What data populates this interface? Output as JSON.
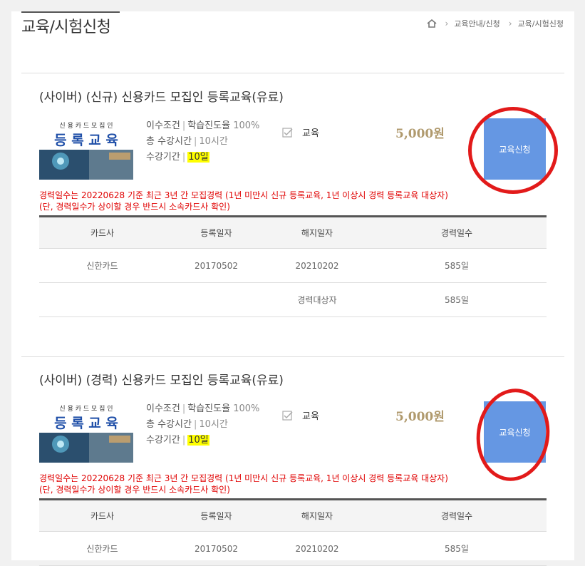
{
  "header": {
    "title": "교육/시험신청",
    "breadcrumb": [
      "교육안내/신청",
      "교육/시험신청"
    ]
  },
  "courses": [
    {
      "title": "(사이버) (신규) 신용카드 모집인 등록교육(유료)",
      "thumb_top": "신 용 카 드  모 집 인",
      "thumb_main": "등 록 교 육",
      "requirement_label": "이수조건",
      "requirement_value": "학습진도율",
      "requirement_pct": "100%",
      "hours_label": "총 수강시간",
      "hours_value": "10시간",
      "period_label": "수강기간",
      "period_value": "10일",
      "category": "교육",
      "price": "5,000원",
      "apply_label": "교육신청",
      "notice1": "경력일수는 20220628 기준 최근 3년 간 모집경력 (1년 미만시 신규 등록교육, 1년 이상시 경력 등록교육 대상자)",
      "notice2": " (단, 경력일수가 상이할 경우 반드시 소속카드사 확인)",
      "columns": [
        "카드사",
        "등록일자",
        "해지일자",
        "경력일수"
      ],
      "rows": [
        [
          "신한카드",
          "20170502",
          "20210202",
          "585일"
        ],
        [
          "",
          "",
          "경력대상자",
          "585일"
        ]
      ]
    },
    {
      "title": "(사이버) (경력) 신용카드 모집인 등록교육(유료)",
      "thumb_top": "신 용 카 드  모 집 인",
      "thumb_main": "등 록 교 육",
      "requirement_label": "이수조건",
      "requirement_value": "학습진도율",
      "requirement_pct": "100%",
      "hours_label": "총 수강시간",
      "hours_value": "10시간",
      "period_label": "수강기간",
      "period_value": "10일",
      "category": "교육",
      "price": "5,000원",
      "apply_label": "교육신청",
      "notice1": "경력일수는 20220628 기준 최근 3년 간 모집경력 (1년 미만시 신규 등록교육, 1년 이상시 경력 등록교육 대상자)",
      "notice2": " (단, 경력일수가 상이할 경우 반드시 소속카드사 확인)",
      "columns": [
        "카드사",
        "등록일자",
        "해지일자",
        "경력일수"
      ],
      "rows": [
        [
          "신한카드",
          "20170502",
          "20210202",
          "585일"
        ]
      ]
    }
  ],
  "colors": {
    "accent": "#6597e3",
    "price": "#b09a6e",
    "notice": "#e00000",
    "highlight": "#ffff00",
    "annotation": "#e21a1a"
  }
}
